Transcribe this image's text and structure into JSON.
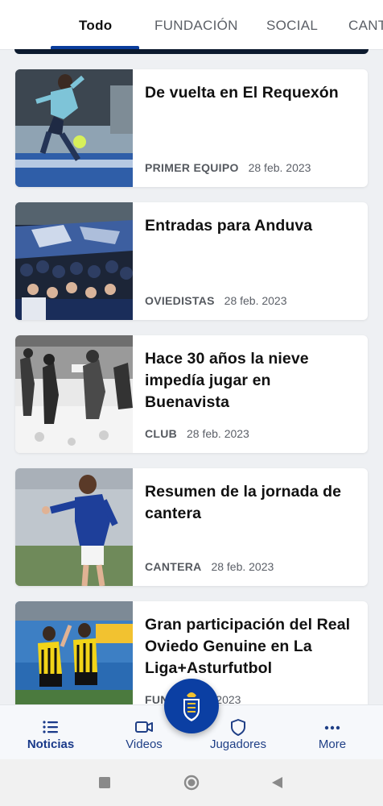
{
  "tabs": [
    {
      "label": "Todo",
      "active": true
    },
    {
      "label": "FUNDACIÓN",
      "active": false
    },
    {
      "label": "SOCIAL",
      "active": false
    },
    {
      "label": "CANT",
      "active": false
    }
  ],
  "articles": [
    {
      "title": "De vuelta en El Requexón",
      "category": "PRIMER EQUIPO",
      "date": "28 feb. 2023",
      "image": "player-training-photo"
    },
    {
      "title": "Entradas para Anduva",
      "category": "OVIEDISTAS",
      "date": "28 feb. 2023",
      "image": "fans-stand-photo"
    },
    {
      "title": "Hace 30 años la nieve impedía jugar en Buenavista",
      "category": "CLUB",
      "date": "28 feb. 2023",
      "image": "snow-match-photo"
    },
    {
      "title": "Resumen de la jornada de cantera",
      "category": "CANTERA",
      "date": "28 feb. 2023",
      "image": "youth-player-photo"
    },
    {
      "title": "Gran participación del Real Oviedo Genuine en La Liga+Asturfutbol",
      "category": "FUN",
      "date": "28 feb. 2023",
      "image": "genuine-players-photo"
    }
  ],
  "bottom_nav": [
    {
      "label": "Noticias",
      "icon": "list-icon",
      "active": true
    },
    {
      "label": "Videos",
      "icon": "video-icon",
      "active": false
    },
    {
      "label": "Jugadores",
      "icon": "shield-icon",
      "active": false
    },
    {
      "label": "More",
      "icon": "more-dots-icon",
      "active": false
    }
  ],
  "fab": {
    "icon": "club-crest-icon"
  },
  "system_nav": [
    "recents-square-icon",
    "home-circle-icon",
    "back-triangle-icon"
  ],
  "colors": {
    "accent": "#0a3d9c",
    "nav_label": "#1f3f86",
    "fab": "#0b3fa3"
  }
}
